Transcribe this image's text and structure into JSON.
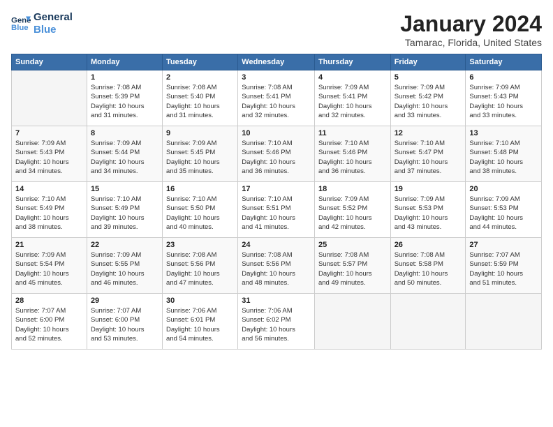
{
  "logo": {
    "line1": "General",
    "line2": "Blue"
  },
  "title": "January 2024",
  "location": "Tamarac, Florida, United States",
  "days_of_week": [
    "Sunday",
    "Monday",
    "Tuesday",
    "Wednesday",
    "Thursday",
    "Friday",
    "Saturday"
  ],
  "weeks": [
    [
      {
        "day": "",
        "info": ""
      },
      {
        "day": "1",
        "info": "Sunrise: 7:08 AM\nSunset: 5:39 PM\nDaylight: 10 hours\nand 31 minutes."
      },
      {
        "day": "2",
        "info": "Sunrise: 7:08 AM\nSunset: 5:40 PM\nDaylight: 10 hours\nand 31 minutes."
      },
      {
        "day": "3",
        "info": "Sunrise: 7:08 AM\nSunset: 5:41 PM\nDaylight: 10 hours\nand 32 minutes."
      },
      {
        "day": "4",
        "info": "Sunrise: 7:09 AM\nSunset: 5:41 PM\nDaylight: 10 hours\nand 32 minutes."
      },
      {
        "day": "5",
        "info": "Sunrise: 7:09 AM\nSunset: 5:42 PM\nDaylight: 10 hours\nand 33 minutes."
      },
      {
        "day": "6",
        "info": "Sunrise: 7:09 AM\nSunset: 5:43 PM\nDaylight: 10 hours\nand 33 minutes."
      }
    ],
    [
      {
        "day": "7",
        "info": "Sunrise: 7:09 AM\nSunset: 5:43 PM\nDaylight: 10 hours\nand 34 minutes."
      },
      {
        "day": "8",
        "info": "Sunrise: 7:09 AM\nSunset: 5:44 PM\nDaylight: 10 hours\nand 34 minutes."
      },
      {
        "day": "9",
        "info": "Sunrise: 7:09 AM\nSunset: 5:45 PM\nDaylight: 10 hours\nand 35 minutes."
      },
      {
        "day": "10",
        "info": "Sunrise: 7:10 AM\nSunset: 5:46 PM\nDaylight: 10 hours\nand 36 minutes."
      },
      {
        "day": "11",
        "info": "Sunrise: 7:10 AM\nSunset: 5:46 PM\nDaylight: 10 hours\nand 36 minutes."
      },
      {
        "day": "12",
        "info": "Sunrise: 7:10 AM\nSunset: 5:47 PM\nDaylight: 10 hours\nand 37 minutes."
      },
      {
        "day": "13",
        "info": "Sunrise: 7:10 AM\nSunset: 5:48 PM\nDaylight: 10 hours\nand 38 minutes."
      }
    ],
    [
      {
        "day": "14",
        "info": "Sunrise: 7:10 AM\nSunset: 5:49 PM\nDaylight: 10 hours\nand 38 minutes."
      },
      {
        "day": "15",
        "info": "Sunrise: 7:10 AM\nSunset: 5:49 PM\nDaylight: 10 hours\nand 39 minutes."
      },
      {
        "day": "16",
        "info": "Sunrise: 7:10 AM\nSunset: 5:50 PM\nDaylight: 10 hours\nand 40 minutes."
      },
      {
        "day": "17",
        "info": "Sunrise: 7:10 AM\nSunset: 5:51 PM\nDaylight: 10 hours\nand 41 minutes."
      },
      {
        "day": "18",
        "info": "Sunrise: 7:09 AM\nSunset: 5:52 PM\nDaylight: 10 hours\nand 42 minutes."
      },
      {
        "day": "19",
        "info": "Sunrise: 7:09 AM\nSunset: 5:53 PM\nDaylight: 10 hours\nand 43 minutes."
      },
      {
        "day": "20",
        "info": "Sunrise: 7:09 AM\nSunset: 5:53 PM\nDaylight: 10 hours\nand 44 minutes."
      }
    ],
    [
      {
        "day": "21",
        "info": "Sunrise: 7:09 AM\nSunset: 5:54 PM\nDaylight: 10 hours\nand 45 minutes."
      },
      {
        "day": "22",
        "info": "Sunrise: 7:09 AM\nSunset: 5:55 PM\nDaylight: 10 hours\nand 46 minutes."
      },
      {
        "day": "23",
        "info": "Sunrise: 7:08 AM\nSunset: 5:56 PM\nDaylight: 10 hours\nand 47 minutes."
      },
      {
        "day": "24",
        "info": "Sunrise: 7:08 AM\nSunset: 5:56 PM\nDaylight: 10 hours\nand 48 minutes."
      },
      {
        "day": "25",
        "info": "Sunrise: 7:08 AM\nSunset: 5:57 PM\nDaylight: 10 hours\nand 49 minutes."
      },
      {
        "day": "26",
        "info": "Sunrise: 7:08 AM\nSunset: 5:58 PM\nDaylight: 10 hours\nand 50 minutes."
      },
      {
        "day": "27",
        "info": "Sunrise: 7:07 AM\nSunset: 5:59 PM\nDaylight: 10 hours\nand 51 minutes."
      }
    ],
    [
      {
        "day": "28",
        "info": "Sunrise: 7:07 AM\nSunset: 6:00 PM\nDaylight: 10 hours\nand 52 minutes."
      },
      {
        "day": "29",
        "info": "Sunrise: 7:07 AM\nSunset: 6:00 PM\nDaylight: 10 hours\nand 53 minutes."
      },
      {
        "day": "30",
        "info": "Sunrise: 7:06 AM\nSunset: 6:01 PM\nDaylight: 10 hours\nand 54 minutes."
      },
      {
        "day": "31",
        "info": "Sunrise: 7:06 AM\nSunset: 6:02 PM\nDaylight: 10 hours\nand 56 minutes."
      },
      {
        "day": "",
        "info": ""
      },
      {
        "day": "",
        "info": ""
      },
      {
        "day": "",
        "info": ""
      }
    ]
  ]
}
